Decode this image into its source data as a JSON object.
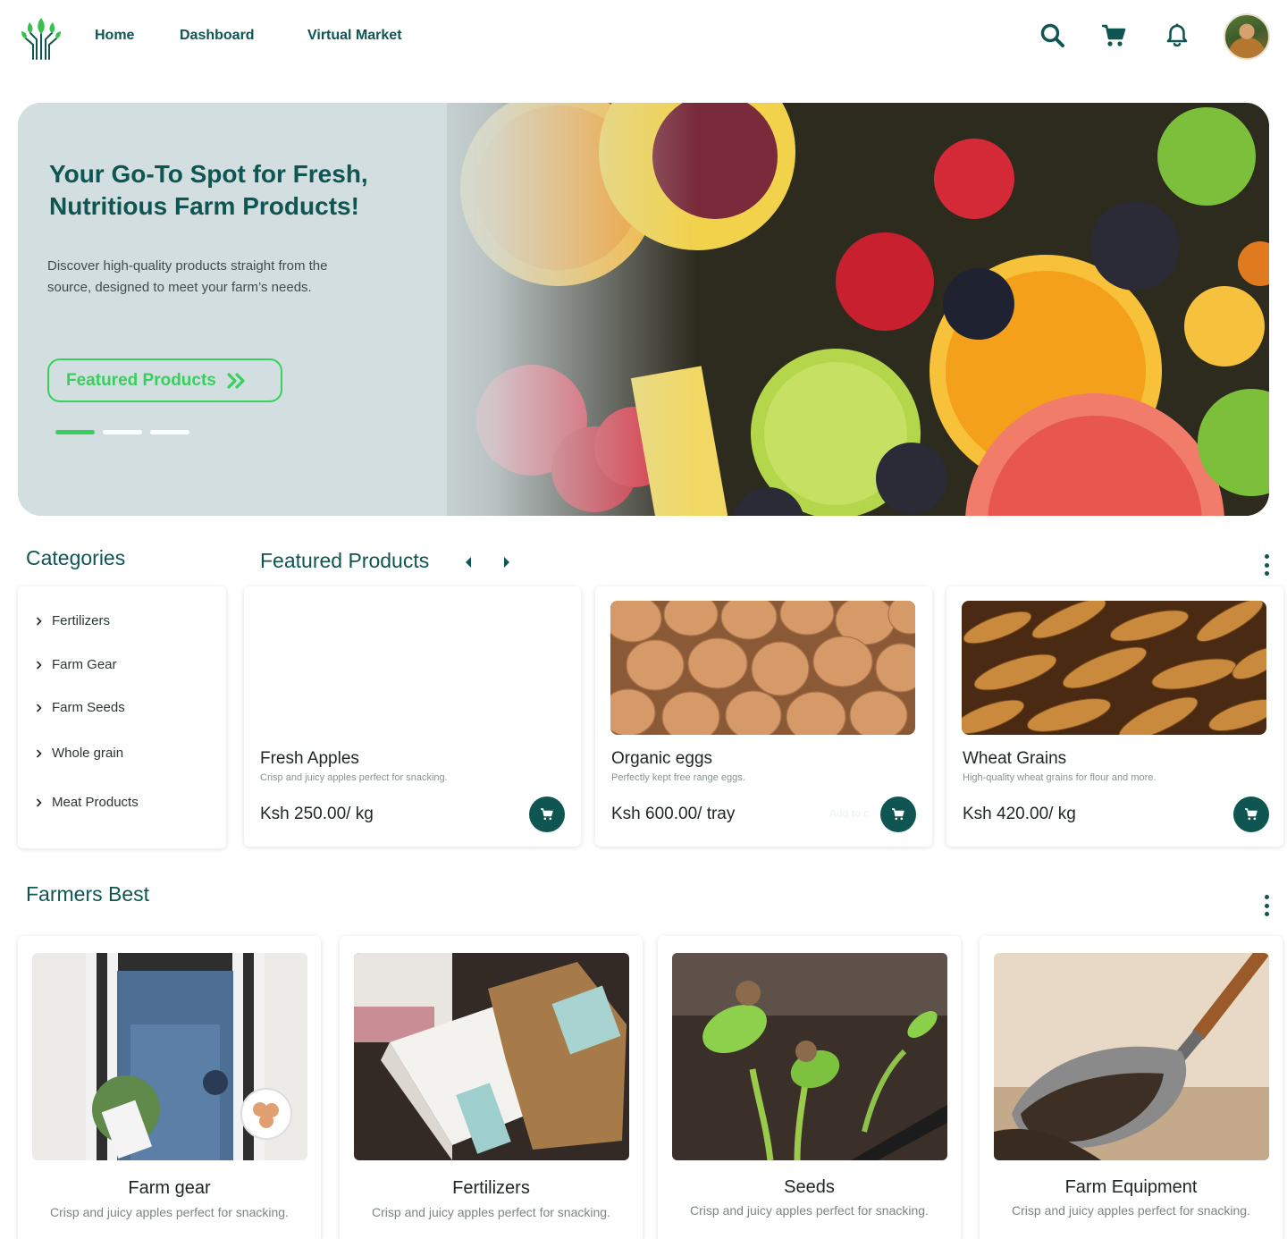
{
  "nav": {
    "links": [
      "Home",
      "Dashboard",
      "Virtual Market"
    ]
  },
  "header_icons": [
    "search-icon",
    "cart-icon",
    "bell-icon",
    "user-avatar"
  ],
  "hero": {
    "title": "Your Go-To Spot for Fresh, Nutritious Farm Products!",
    "description": "Discover high-quality products straight from the source, designed to meet your farm’s needs.",
    "button_label": "Featured Products",
    "slides": 3,
    "active_slide": 1
  },
  "categories": {
    "title": "Categories",
    "items": [
      "Fertilizers",
      "Farm Gear",
      "Farm Seeds",
      "Whole grain",
      "Meat Products"
    ]
  },
  "featured": {
    "title": "Featured Products",
    "products": [
      {
        "name": "Fresh Apples",
        "description": "Crisp and juicy apples perfect for snacking.",
        "price": "Ksh 250.00/ kg",
        "image": "empty"
      },
      {
        "name": "Organic eggs",
        "description": "Perfectly kept free range eggs.",
        "price": "Ksh 600.00/ tray",
        "hover_label": "Add to c",
        "image": "eggs-photo"
      },
      {
        "name": "Wheat Grains",
        "description": "High-quality wheat grains for flour and more.",
        "price": "Ksh 420.00/ kg",
        "image": "wheat-photo"
      }
    ]
  },
  "farmers_best": {
    "title": "Farmers Best",
    "items": [
      {
        "title": "Farm gear",
        "description": "Crisp and juicy apples perfect for snacking.",
        "image": "overalls-photo"
      },
      {
        "title": "Fertilizers",
        "description": "Crisp and juicy apples perfect for snacking.",
        "image": "packages-photo"
      },
      {
        "title": "Seeds",
        "description": "Crisp and juicy apples perfect for snacking.",
        "image": "seedlings-photo"
      },
      {
        "title": "Farm Equipment",
        "description": "Crisp and juicy apples perfect for snacking.",
        "image": "soil-scoop-photo"
      }
    ]
  },
  "colors": {
    "primary": "#0f5552",
    "accent": "#37d05c",
    "hero_bg": "#d3dfe1"
  }
}
